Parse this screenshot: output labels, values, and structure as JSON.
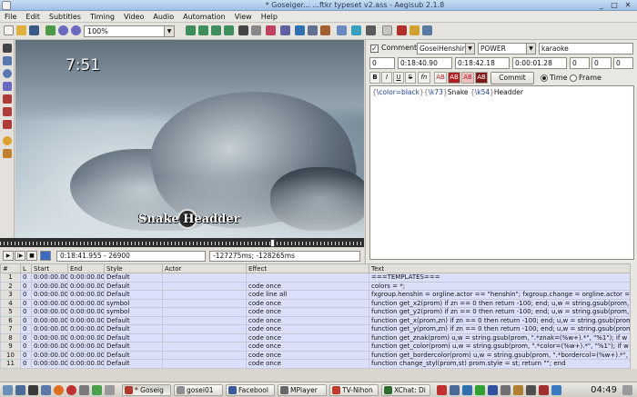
{
  "window": {
    "title": "* Goseiger... ...ftkr typeset v2.ass - Aegisub 2.1.8",
    "minimize": "_",
    "maximize": "□",
    "close": "✕"
  },
  "menu": [
    "File",
    "Edit",
    "Subtitles",
    "Timing",
    "Video",
    "Audio",
    "Automation",
    "View",
    "Help"
  ],
  "toolbar": {
    "zoom_value": "100%"
  },
  "video": {
    "clock_overlay": "7:51",
    "caption_overlay": "Snake Headder",
    "time_field": "0:18:41.955 - 26900",
    "offset_field": "-127275ms; -128265ms"
  },
  "editor": {
    "comment_label": "Comment",
    "comment_checked": true,
    "style": "GoseiHenshin",
    "actor": "POWER",
    "effect": "karaoke",
    "layer": "0",
    "start": "0:18:40.90",
    "end": "0:18:42.18",
    "duration": "0:00:01.28",
    "margin_l": "0",
    "margin_r": "0",
    "margin_v": "0",
    "format_buttons": [
      "B",
      "I",
      "U",
      "S",
      "fn",
      "AB",
      "AB",
      "AB",
      "AB"
    ],
    "commit_label": "Commit",
    "time_label": "Time",
    "frame_label": "Frame",
    "mode": "Time",
    "text_parts": [
      {
        "t": "{",
        "k": "br"
      },
      {
        "t": "\\color=black",
        "k": "tag"
      },
      {
        "t": "}",
        "k": "br"
      },
      {
        "t": "{",
        "k": "br"
      },
      {
        "t": "\\k73",
        "k": "tag"
      },
      {
        "t": "}",
        "k": "br"
      },
      {
        "t": "Snake ",
        "k": "plain"
      },
      {
        "t": "{",
        "k": "br"
      },
      {
        "t": "\\k54",
        "k": "tag"
      },
      {
        "t": "}",
        "k": "br"
      },
      {
        "t": "Headder",
        "k": "plain"
      }
    ]
  },
  "grid": {
    "columns": [
      "#",
      "L",
      "Start",
      "End",
      "Style",
      "Actor",
      "Effect",
      "Text"
    ],
    "rows": [
      [
        "1",
        "0",
        "0:00:00.00",
        "0:00:00.00",
        "Default",
        "",
        "",
        "===TEMPLATES==="
      ],
      [
        "2",
        "0",
        "0:00:00.00",
        "0:00:00.00",
        "Default",
        "",
        "code once",
        "colors = *;"
      ],
      [
        "3",
        "0",
        "0:00:00.00",
        "0:00:00.00",
        "Default",
        "",
        "code line all",
        "fxgroup.henshin = orgline.actor == \"henshin\"; fxgroup.change = orgline.actor == \"change\"; fxgroup.power ="
      ],
      [
        "4",
        "0",
        "0:00:00.00",
        "0:00:00.00",
        "symbol",
        "",
        "code once",
        "function get_x2(prom) if zn == 0 then return -100; end; u,w = string.gsub(prom, \".*\\pos%(\"); u,w ="
      ],
      [
        "5",
        "0",
        "0:00:00.00",
        "0:00:00.00",
        "symbol",
        "",
        "code once",
        "function get_y2(prom) if zn == 0 then return -100; end; u,w = string.gsub(prom, \".*\\pos%(\"); u,w ="
      ],
      [
        "6",
        "0",
        "0:00:00.00",
        "0:00:00.00",
        "Default",
        "",
        "code once",
        "function get_x(prom,zn) if zn == 0 then return -100; end; u,w = string.gsub(prom, \".*\\pos%(\"); u,w ="
      ],
      [
        "7",
        "0",
        "0:00:00.00",
        "0:00:00.00",
        "Default",
        "",
        "code once",
        "function get_y(prom,zn) if zn == 0 then return -100; end; u,w = string.gsub(prom, \".*\\pos%(\"); u,w ="
      ],
      [
        "8",
        "0",
        "0:00:00.00",
        "0:00:00.00",
        "Default",
        "",
        "code once",
        "function get_znak(prom) u,w = string.gsub(prom, \".*znak=(%w+).*\", \"%1\"); if w == 0 then return"
      ],
      [
        "9",
        "0",
        "0:00:00.00",
        "0:00:00.00",
        "Default",
        "",
        "code once",
        "function get_color(prom) u,w = string.gsub(prom, \".*color=(%w+).*\", \"%1\"); if w == 0 then return"
      ],
      [
        "10",
        "0",
        "0:00:00.00",
        "0:00:00.00",
        "Default",
        "",
        "code once",
        "function get_bordercolor(prom) u,w = string.gsub(prom, \".*bordercol=(%w+).*\", \"%1\"); if w == 0"
      ],
      [
        "11",
        "0",
        "0:00:00.00",
        "0:00:00.00",
        "Default",
        "",
        "code once",
        "function change_styl(prom,st) prom.style = st; return \"\"; end"
      ]
    ]
  },
  "taskbar": {
    "tasks": [
      {
        "label": "* Goseig",
        "color": "#b03a2e",
        "active": true
      },
      {
        "label": "gosei01",
        "color": "#8e8e8e",
        "active": false
      },
      {
        "label": "Facebool",
        "color": "#3b5998",
        "active": false
      },
      {
        "label": "MPlayer",
        "color": "#666666",
        "active": false
      },
      {
        "label": "TV-Nihon",
        "color": "#c0392b",
        "active": false
      },
      {
        "label": "XChat: Di",
        "color": "#2e6b2e",
        "active": false
      }
    ],
    "clock": "04:49"
  }
}
